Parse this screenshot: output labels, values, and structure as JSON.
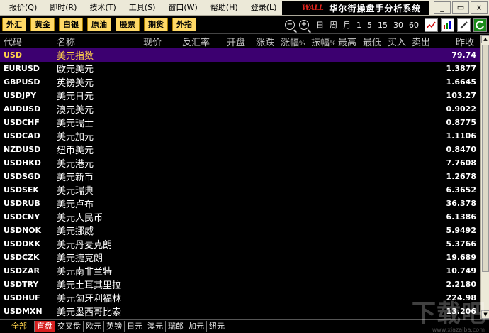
{
  "menu": [
    "报价(Q)",
    "即时(R)",
    "技术(T)",
    "工具(S)",
    "窗口(W)",
    "帮助(H)",
    "登录(L)"
  ],
  "brand": {
    "logo": "WALL",
    "name": "华尔街操盘手分析系统"
  },
  "window_buttons": {
    "minimize": "_",
    "restore": "▭",
    "close": "×"
  },
  "categories": [
    "外汇",
    "黄金",
    "白银",
    "原油",
    "股票",
    "期货",
    "外指"
  ],
  "periods": [
    "日",
    "周",
    "月",
    "1",
    "5",
    "15",
    "30",
    "60"
  ],
  "columns": {
    "code": "代码",
    "name": "名称",
    "now": "现价",
    "fhl": "反汇率",
    "open": "开盘",
    "chg": "涨跌",
    "chgp": "涨幅",
    "amp": "振幅",
    "pct": "%",
    "high": "最高",
    "low": "最低",
    "buy": "买入",
    "sell": "卖出",
    "yest": "昨收"
  },
  "rows": [
    {
      "code": "USD",
      "name": "美元指数",
      "yest": "79.74"
    },
    {
      "code": "EURUSD",
      "name": "欧元美元",
      "yest": "1.3877"
    },
    {
      "code": "GBPUSD",
      "name": "英镑美元",
      "yest": "1.6645"
    },
    {
      "code": "USDJPY",
      "name": "美元日元",
      "yest": "103.27"
    },
    {
      "code": "AUDUSD",
      "name": "澳元美元",
      "yest": "0.9022"
    },
    {
      "code": "USDCHF",
      "name": "美元瑞士",
      "yest": "0.8775"
    },
    {
      "code": "USDCAD",
      "name": "美元加元",
      "yest": "1.1106"
    },
    {
      "code": "NZDUSD",
      "name": "纽币美元",
      "yest": "0.8470"
    },
    {
      "code": "USDHKD",
      "name": "美元港元",
      "yest": "7.7608"
    },
    {
      "code": "USDSGD",
      "name": "美元新币",
      "yest": "1.2678"
    },
    {
      "code": "USDSEK",
      "name": "美元瑞典",
      "yest": "6.3652"
    },
    {
      "code": "USDRUB",
      "name": "美元卢布",
      "yest": "36.378"
    },
    {
      "code": "USDCNY",
      "name": "美元人民币",
      "yest": "6.1386"
    },
    {
      "code": "USDNOK",
      "name": "美元挪威",
      "yest": "5.9492"
    },
    {
      "code": "USDDKK",
      "name": "美元丹麦克朗",
      "yest": "5.3766"
    },
    {
      "code": "USDCZK",
      "name": "美元捷克朗",
      "yest": "19.689"
    },
    {
      "code": "USDZAR",
      "name": "美元南非兰特",
      "yest": "10.749"
    },
    {
      "code": "USDTRY",
      "name": "美元土耳其里拉",
      "yest": "2.2180"
    },
    {
      "code": "USDHUF",
      "name": "美元匈牙利福林",
      "yest": "224.98"
    },
    {
      "code": "USDMXN",
      "name": "美元墨西哥比索",
      "yest": "13.206"
    }
  ],
  "tabs": [
    "全部",
    "直盘",
    "交叉盘",
    "欧元",
    "英镑",
    "日元",
    "澳元",
    "瑞郎",
    "加元",
    "纽元"
  ],
  "watermark": {
    "main": "下载吧",
    "sub": "www.xiazaiba.com"
  },
  "colors": {
    "selected_row": "#3c0070",
    "category_button": "#ffd966",
    "active_tab": "#d62020"
  }
}
